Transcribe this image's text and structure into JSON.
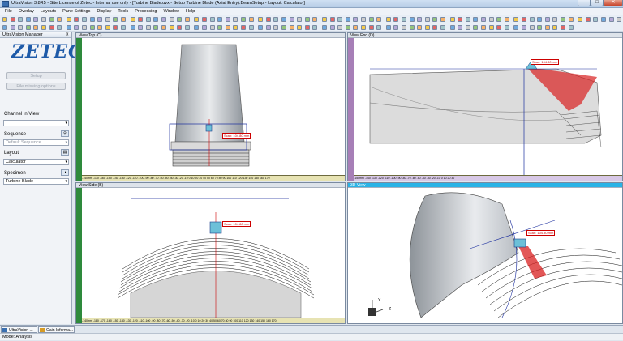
{
  "window": {
    "title": "UltraVision 3.8R5 - Site License of Zetec - Internal use only - [Turbine Blade.uvx - Setup Turbine Blade (Axial Entry).BeamSetup - Layout: Calculator]",
    "min": "–",
    "max": "□",
    "close": "✕"
  },
  "menu": [
    "File",
    "Overlay",
    "Layouts",
    "Pane Settings",
    "Display",
    "Tools",
    "Processing",
    "Window",
    "Help"
  ],
  "left_panel": {
    "header": "UltraVision Manager",
    "close": "✕",
    "logo": "ZETEC",
    "setup_button": "Setup",
    "file_missing_button": "File missing options",
    "channel_label": "Channel in View",
    "channel_value": "",
    "sequence_label": "Sequence",
    "sequence_value": "Default Sequence",
    "layout_label": "Layout",
    "layout_value": "Calculator",
    "specimen_label": "Specimen",
    "specimen_value": "Turbine Blade"
  },
  "views": {
    "top": {
      "title": "View Top (C)",
      "scan_label": "Scan: 104.80 mm",
      "ruler": "-140mm  -170  -160  -150  -140  -130  -120  -110  -100  -90  -80  -70  -60  -50  -40  -30  -20  -10  0  10  20  30  40  50  60  70  80  90  100  110  120  130  140  150  160  170"
    },
    "end": {
      "title": "View End (D)",
      "scan_label": "Scan: 104.80 mm",
      "ruler": "-150mm  -140  -130  -120  -110  -100  -90  -80  -70  -60  -50  -40  -30  -20  -10  0  10  20  30"
    },
    "side": {
      "title": "View Side (B)",
      "scan_label": "Scan: 104.80 mm",
      "ruler": "-140mm  -180  -170  -160  -150  -140  -130  -120  -110  -100  -90  -80  -70  -60  -50  -40  -30  -20  -10  0  10  20  30  40  50  60  70  80  90  100  110  120  130  140  150  160  170"
    },
    "v3d": {
      "title": "3D View",
      "scan_label": "Scan: 104.80 mm",
      "axis_y": "Y",
      "axis_z": "Z"
    }
  },
  "taskbar": [
    {
      "label": "UltraVision ..."
    },
    {
      "label": "Gain Informa..."
    }
  ],
  "status": "Mode: Analysis",
  "colors": {
    "accent": "#29b3e6",
    "ruler_green": "#2e8a3c",
    "ruler_purple": "#a77fb7",
    "beam_red": "#d81f1f"
  }
}
